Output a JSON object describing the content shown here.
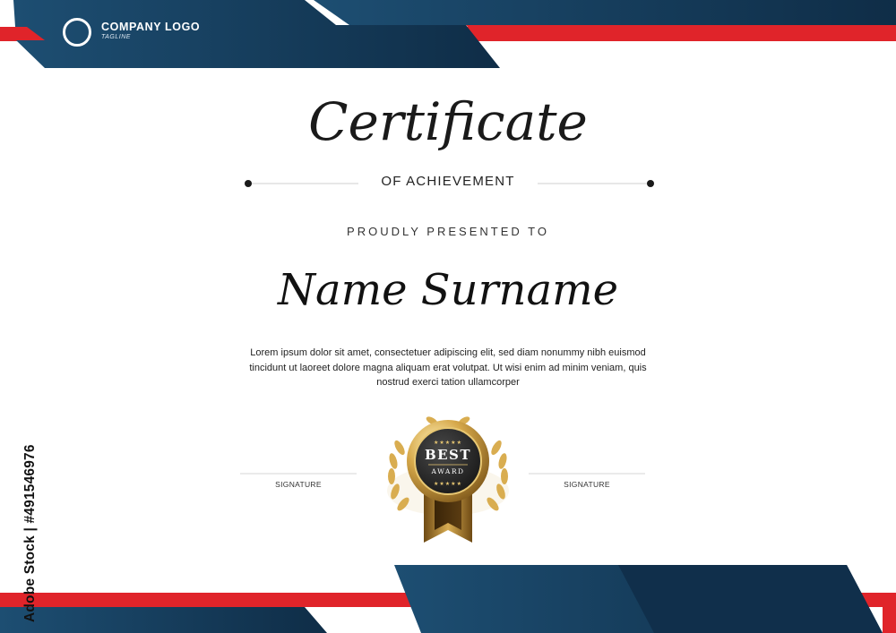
{
  "logo": {
    "name": "COMPANY LOGO",
    "tagline": "TAGLINE"
  },
  "certificate": {
    "title": "Certificate",
    "subtitle": "OF ACHIEVEMENT",
    "presented_to": "PROUDLY PRESENTED TO",
    "recipient": "Name Surname",
    "body": "Lorem ipsum dolor sit amet, consectetuer adipiscing elit, sed diam nonummy nibh euismod tincidunt ut laoreet dolore magna aliquam erat volutpat. Ut wisi enim ad minim veniam, quis nostrud exerci tation ullamcorper"
  },
  "signatures": {
    "left_label": "SIGNATURE",
    "right_label": "SIGNATURE"
  },
  "badge": {
    "line1": "BEST",
    "line2": "AWARD",
    "stars": 5
  },
  "watermark": {
    "text": "Adobe Stock | #491546976"
  },
  "colors": {
    "navy": "#153b5a",
    "red": "#e0242a",
    "gold": "#c79a3a",
    "ink": "#1a1a1a"
  }
}
